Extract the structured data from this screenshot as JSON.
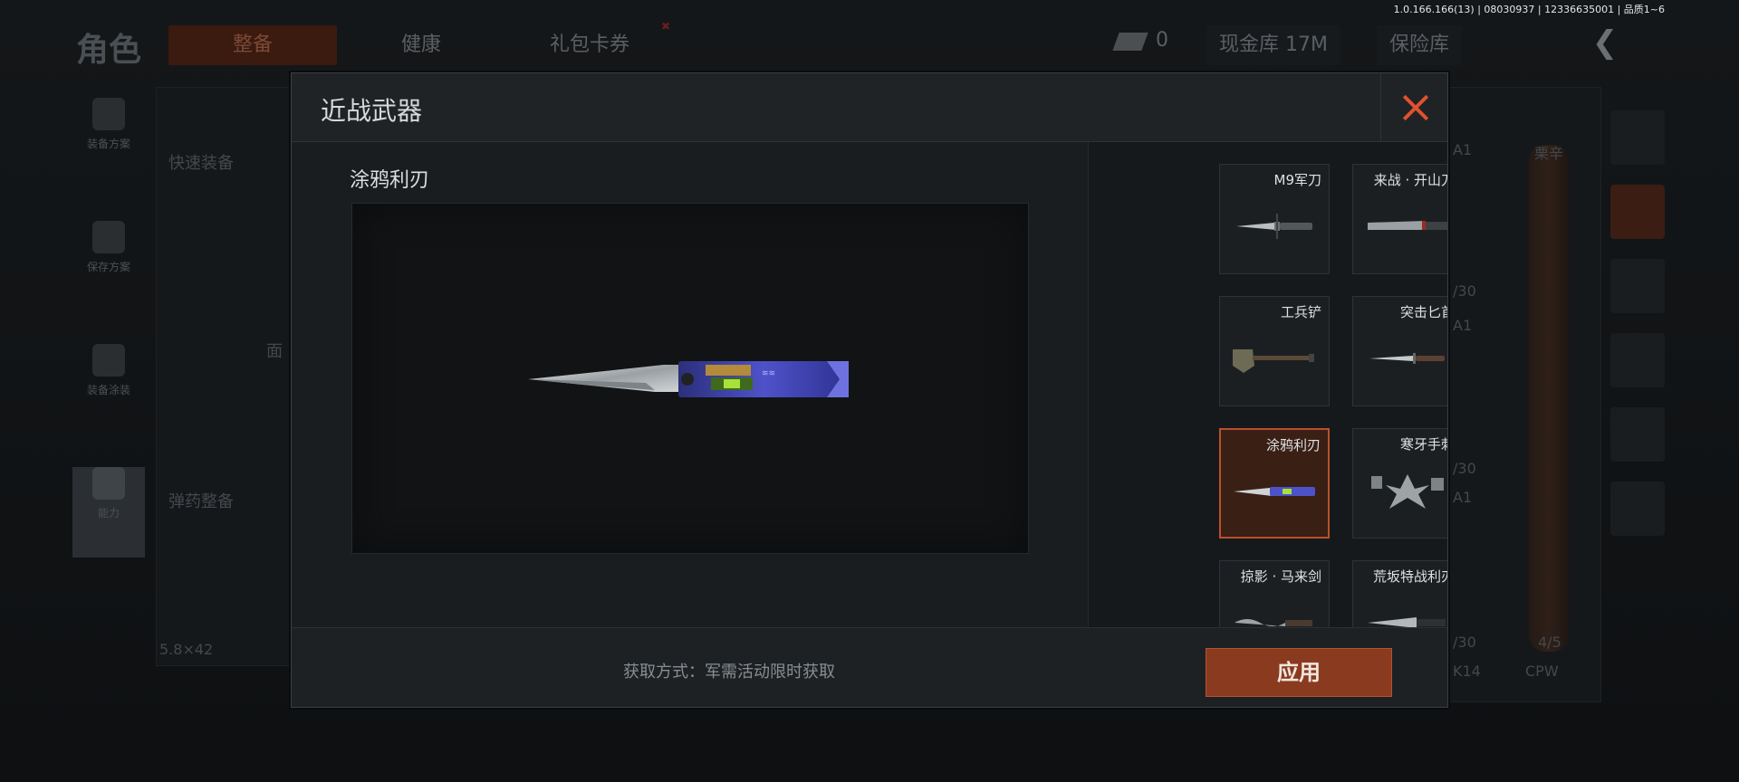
{
  "version": "1.0.166.166(13) | 08030937 | 12336635001 | 品质1~6",
  "background": {
    "title": "角色",
    "tabs": [
      "整备",
      "健康",
      "礼包卡券"
    ],
    "ticket_count": "0",
    "cash_vault": "现金库 17M",
    "insurance": "保险库",
    "side_items": [
      "装备方案",
      "保存方案",
      "装备涂装",
      "能力"
    ],
    "quick_equip": "快速装备",
    "ammo_equip": "弹药整备",
    "ammo_caliber": "5.8×42",
    "face_label": "面",
    "right_labels": [
      "/30",
      "/30",
      "/30",
      "4/5",
      "K14",
      "CPW",
      "A1",
      "A1",
      "A1",
      "栗辛"
    ]
  },
  "modal": {
    "title": "近战武器",
    "selected_name": "涂鸦利刃",
    "weapons": [
      {
        "name": "M9军刀",
        "icon": "bayonet-icon",
        "selected": false
      },
      {
        "name": "来战 · 开山刀",
        "icon": "machete-icon",
        "selected": false
      },
      {
        "name": "工兵铲",
        "icon": "shovel-icon",
        "selected": false
      },
      {
        "name": "突击匕首",
        "icon": "dagger-icon",
        "selected": false
      },
      {
        "name": "涂鸦利刃",
        "icon": "butterfly-knife-icon",
        "selected": true
      },
      {
        "name": "寒牙手刺",
        "icon": "claw-icon",
        "selected": false
      },
      {
        "name": "掠影 · 马来剑",
        "icon": "kris-icon",
        "selected": false
      },
      {
        "name": "荒坂特战利刃",
        "icon": "blade-icon",
        "selected": false
      }
    ],
    "obtain_text": "获取方式：军需活动限时获取",
    "apply_label": "应用"
  },
  "colors": {
    "accent": "#b8512c",
    "close": "#e0512f",
    "apply_bg": "#8a3a1f"
  }
}
